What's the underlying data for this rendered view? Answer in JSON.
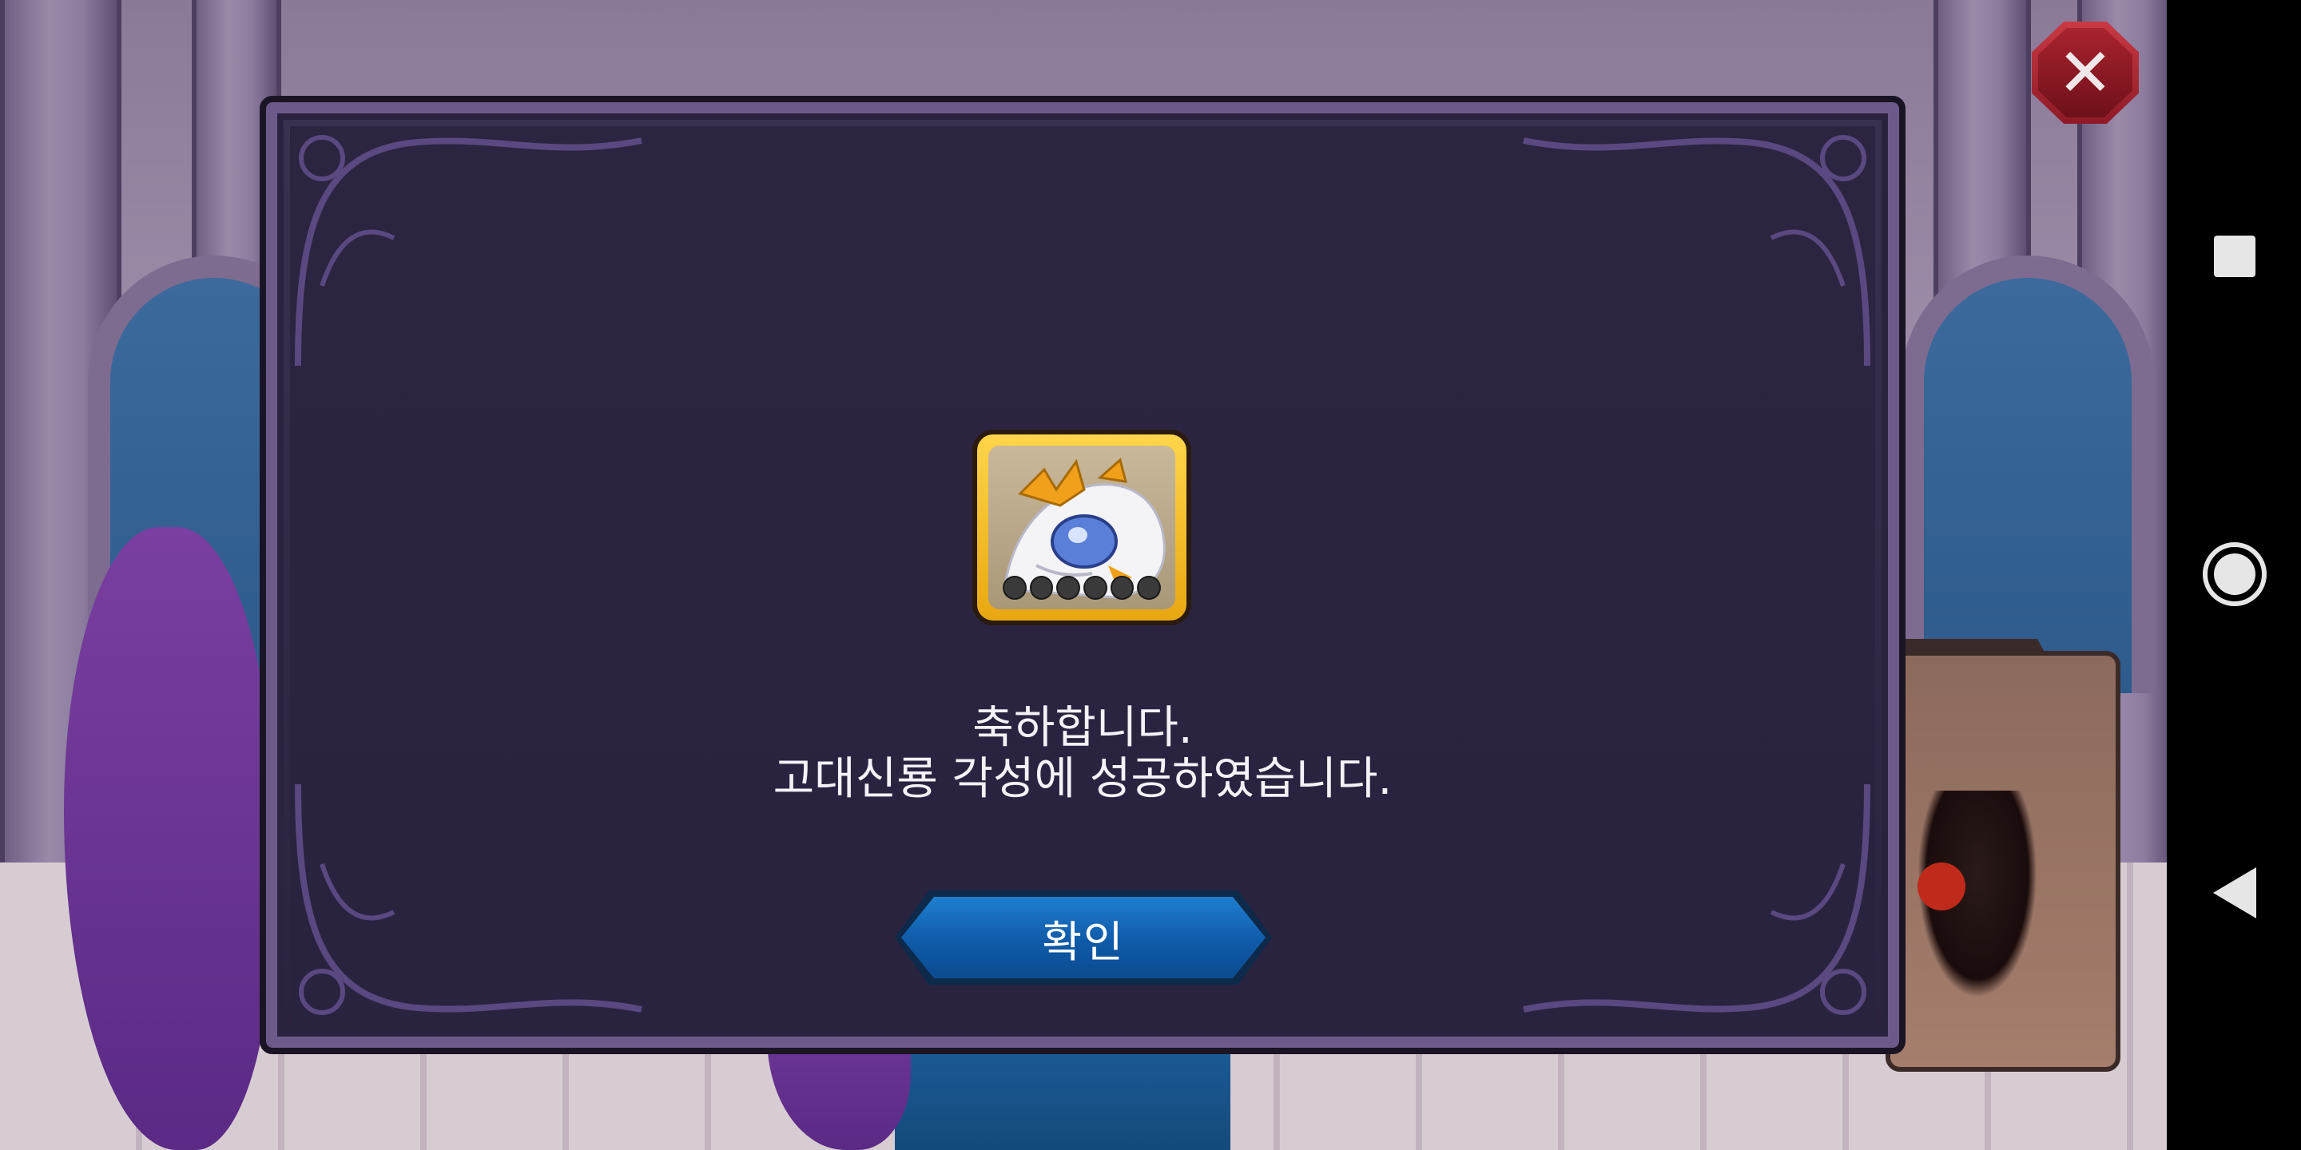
{
  "dialog": {
    "message_line1": "축하합니다.",
    "message_line2": "고대신룡 각성에 성공하였습니다.",
    "confirm_label": "확인",
    "reward_stars_total": 6,
    "reward_stars_filled": 0
  },
  "icons": {
    "close": "close-icon",
    "reward": "ancient-dragon-portrait-icon",
    "nav_recents": "recents-square-icon",
    "nav_home": "home-circle-icon",
    "nav_back": "back-triangle-icon"
  },
  "colors": {
    "dialog_bg": "#2b2240",
    "dialog_border": "#6c5a8a",
    "confirm_button": "#0f5aa8",
    "close_button": "#a8232f",
    "reward_frame": "#f2c12c",
    "nav_bar": "#000000"
  }
}
